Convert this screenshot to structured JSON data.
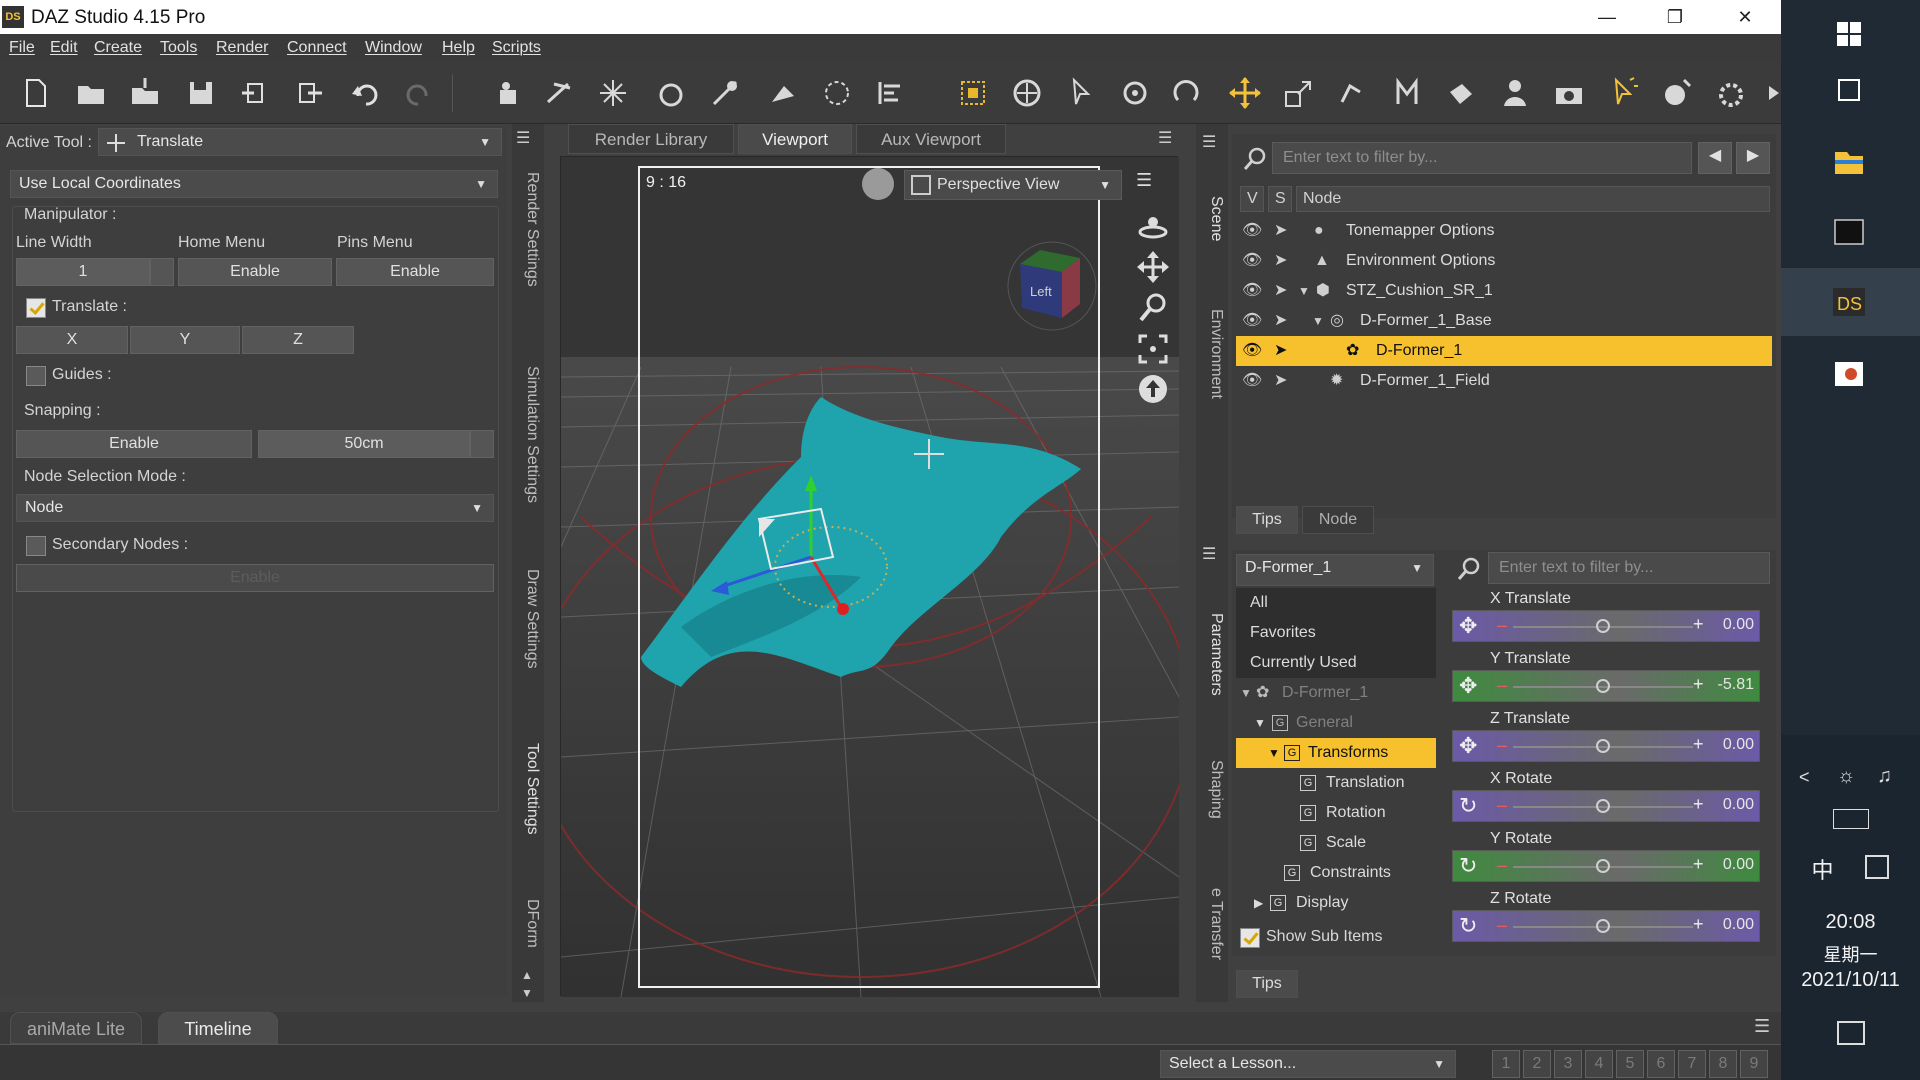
{
  "titlebar": {
    "title": "DAZ Studio 4.15 Pro",
    "logo": "DS"
  },
  "menu": [
    "File",
    "Edit",
    "Create",
    "Tools",
    "Render",
    "Connect",
    "Window",
    "Help",
    "Scripts"
  ],
  "left": {
    "active_tool_label": "Active Tool :",
    "active_tool_value": "Translate",
    "coord_mode": "Use Local Coordinates",
    "manipulator": "Manipulator :",
    "line_width_label": "Line Width",
    "home_menu_label": "Home Menu",
    "pins_menu_label": "Pins Menu",
    "line_width_value": "1",
    "home_menu_btn": "Enable",
    "pins_menu_btn": "Enable",
    "translate_label": "Translate :",
    "axis_x": "X",
    "axis_y": "Y",
    "axis_z": "Z",
    "guides_label": "Guides :",
    "snapping_label": "Snapping :",
    "snapping_btn": "Enable",
    "snapping_value": "50cm",
    "node_sel_label": "Node Selection Mode :",
    "node_sel_value": "Node",
    "secondary_label": "Secondary Nodes :",
    "secondary_btn": "Enable"
  },
  "vstrip_left": [
    "Render Settings",
    "Simulation Settings",
    "Draw Settings",
    "Tool Settings",
    "DForm"
  ],
  "viewport": {
    "tabs": [
      "Render Library",
      "Viewport",
      "Aux Viewport"
    ],
    "ratio": "9 : 16",
    "view": "Perspective View",
    "cube_face": "Left"
  },
  "vstrip_right": [
    "Scene",
    "Environment",
    "Parameters",
    "Shaping",
    "e Transfer"
  ],
  "scene": {
    "search_placeholder": "Enter text to filter by...",
    "col_v": "V",
    "col_s": "S",
    "col_node": "Node",
    "nodes": [
      "Tonemapper Options",
      "Environment Options",
      "STZ_Cushion_SR_1",
      "D-Former_1_Base",
      "D-Former_1",
      "D-Former_1_Field"
    ],
    "tab_tips": "Tips",
    "tab_node": "Node"
  },
  "params": {
    "node_select": "D-Former_1",
    "search_placeholder": "Enter text to filter by...",
    "tree": [
      "All",
      "Favorites",
      "Currently Used",
      "D-Former_1",
      "General",
      "Transforms",
      "Translation",
      "Rotation",
      "Scale",
      "Constraints",
      "Display"
    ],
    "show_sub": "Show Sub Items",
    "sliders": [
      {
        "label": "X Translate",
        "value": "0.00",
        "pos": 0.5,
        "color": "#6b5aa8"
      },
      {
        "label": "Y Translate",
        "value": "-5.81",
        "pos": 0.5,
        "color": "#3f8a3f"
      },
      {
        "label": "Z Translate",
        "value": "0.00",
        "pos": 0.5,
        "color": "#6b5aa8"
      },
      {
        "label": "X Rotate",
        "value": "0.00",
        "pos": 0.5,
        "color": "#6b5aa8"
      },
      {
        "label": "Y Rotate",
        "value": "0.00",
        "pos": 0.5,
        "color": "#3f8a3f"
      },
      {
        "label": "Z Rotate",
        "value": "0.00",
        "pos": 0.5,
        "color": "#6b5aa8"
      }
    ],
    "tips": "Tips"
  },
  "bottom": {
    "tabs": [
      "aniMate Lite",
      "Timeline"
    ],
    "lesson": "Select a Lesson...",
    "pages": [
      "1",
      "2",
      "3",
      "4",
      "5",
      "6",
      "7",
      "8",
      "9"
    ]
  },
  "taskbar": {
    "time": "20:08",
    "weekday": "星期一",
    "date": "2021/10/11",
    "ime": "中"
  }
}
